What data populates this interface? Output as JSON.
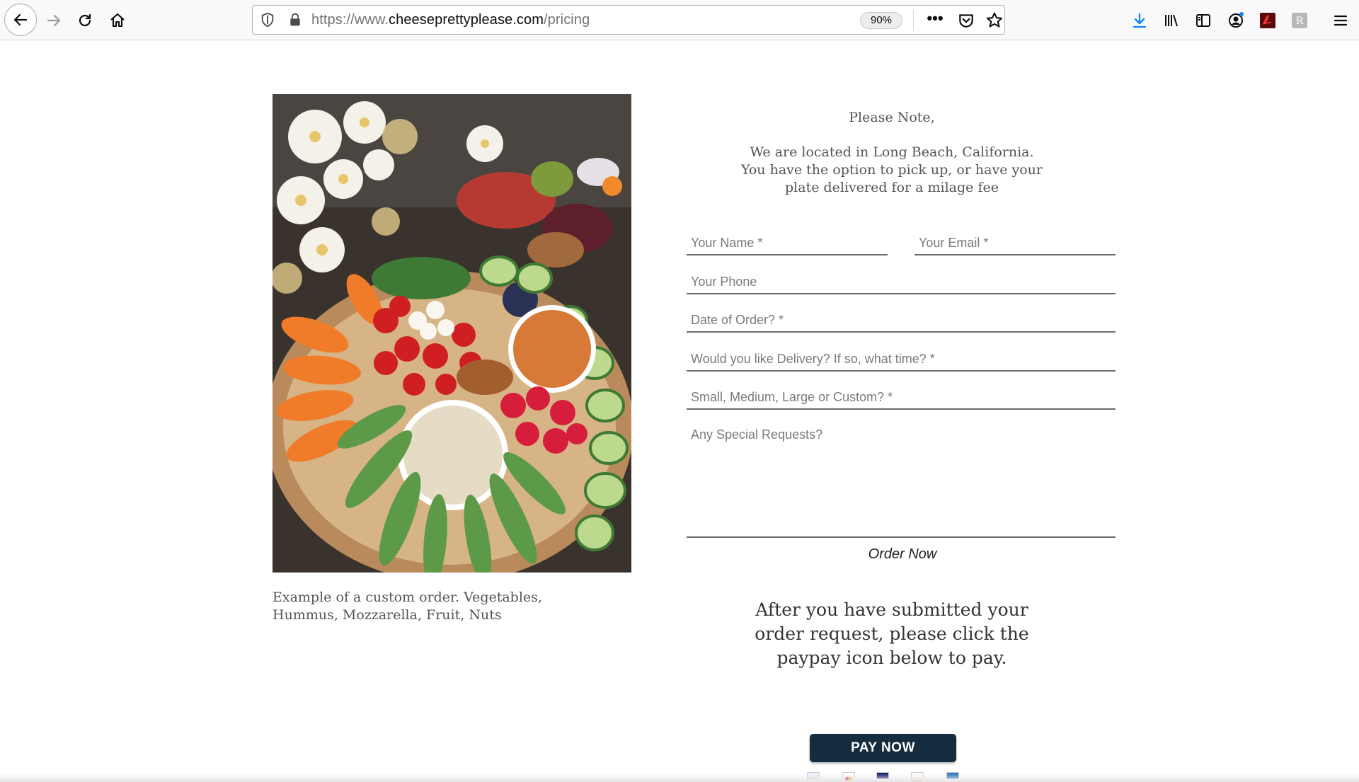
{
  "browser": {
    "url_prefix": "https://www.",
    "url_domain": "cheeseprettyplease.com",
    "url_path": "/pricing",
    "zoom": "90%",
    "more_label": "•••"
  },
  "page": {
    "caption_line1": "Example of a custom order. Vegetables,",
    "caption_line2": "Hummus, Mozzarella, Fruit, Nuts",
    "note_title": "Please Note,",
    "note_line1": "We are located in Long Beach, California.",
    "note_line2": "You have the option to pick up, or have your",
    "note_line3": "plate delivered for a milage fee",
    "form": {
      "name_placeholder": "Your Name *",
      "email_placeholder": "Your Email *",
      "phone_placeholder": "Your Phone",
      "date_placeholder": "Date of Order? *",
      "delivery_placeholder": "Would you like Delivery? If so, what time? *",
      "size_placeholder": "Small, Medium, Large or Custom? *",
      "requests_placeholder": "Any Special Requests?",
      "submit_label": "Order Now"
    },
    "after_line1": "After you have submitted your",
    "after_line2": "order request, please click the",
    "after_line3": "paypay icon below to pay.",
    "pay_label": "PAY NOW",
    "card_icons": [
      "paypal-card-icon",
      "mastercard-icon",
      "visa-icon",
      "discover-icon",
      "amex-icon"
    ]
  },
  "colors": {
    "accent_blue": "#0a84ff",
    "pay_button": "#142c3e"
  }
}
